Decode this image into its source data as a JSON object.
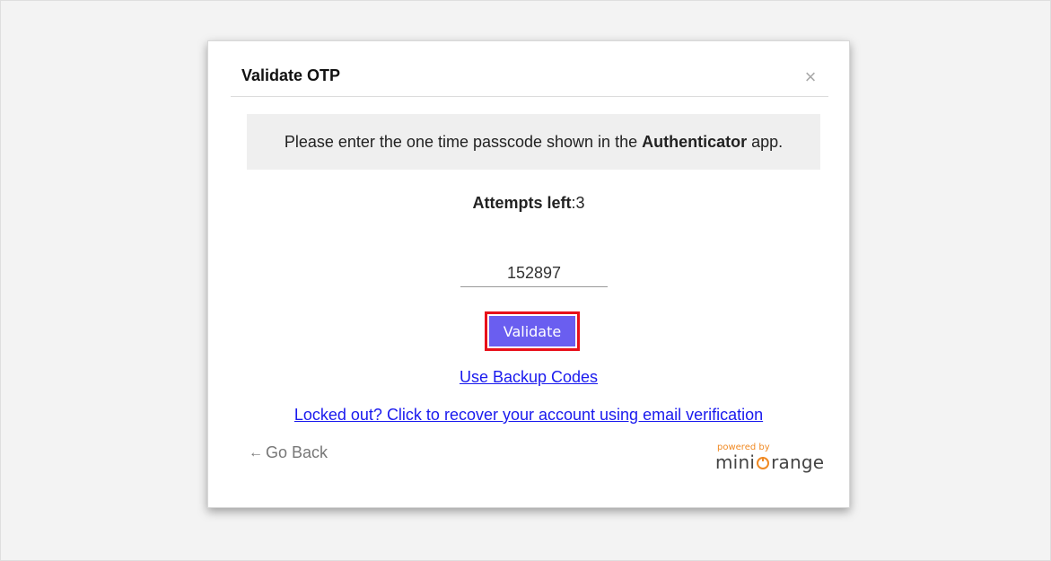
{
  "modal": {
    "title": "Validate OTP",
    "close_symbol": "×",
    "info": {
      "prefix": "Please enter the one time passcode shown in the",
      "app_name": "Authenticator",
      "suffix": "app."
    },
    "attempts": {
      "label": "Attempts left",
      "separator": ":",
      "value": "3"
    },
    "otp_input": {
      "value": "152897"
    },
    "validate_label": "Validate",
    "backup_link": "Use Backup Codes",
    "recover_link": "Locked out? Click to recover your account using email verification",
    "go_back": {
      "arrow": "←",
      "label": "Go Back"
    },
    "brand": {
      "powered_by": "powered by",
      "name_left": "mini",
      "name_right": "range",
      "accent_color": "#f08a24"
    },
    "colors": {
      "button_bg": "#6a5ef0",
      "highlight_border": "#e8101a",
      "link": "#1a1aee"
    }
  }
}
